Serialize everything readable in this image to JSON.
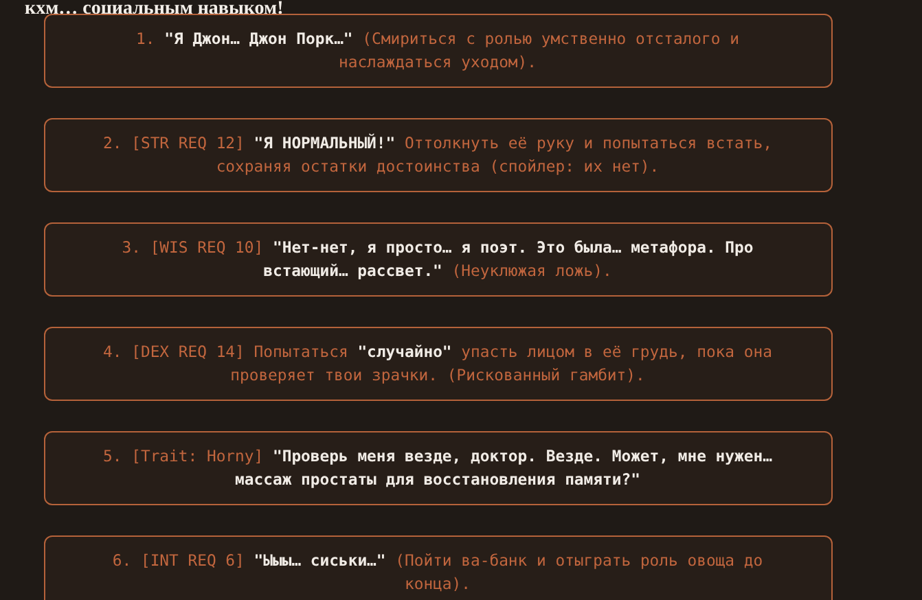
{
  "heading": "кхм… социальным навыком!",
  "options": [
    {
      "text": "1. **\"Я Джон… Джон Порк…\"** (Смириться с ролью умственно отсталого и наслаждаться уходом)."
    },
    {
      "text": "2. [STR REQ 12] **\"Я НОРМАЛЬНЫЙ!\"** Оттолкнуть её руку и попытаться встать, сохраняя остатки достоинства (спойлер: их нет)."
    },
    {
      "text": "3. [WIS REQ 10] **\"Нет-нет, я просто… я поэт. Это была… метафора. Про встающий… рассвет.\"** (Неуклюжая ложь)."
    },
    {
      "text": "4. [DEX REQ 14] Попытаться **\"случайно\"** упасть лицом в её грудь, пока она проверяет твои зрачки. (Рискованный гамбит)."
    },
    {
      "text": "5. [Trait: Horny] **\"Проверь меня везде, доктор. Везде. Может, мне нужен… массаж простаты для восстановления памяти?\"**"
    },
    {
      "text": "6. [INT REQ 6] **\"Ыыы… сиськи…\"** (Пойти ва-банк и отыграть роль овоща до конца)."
    }
  ]
}
